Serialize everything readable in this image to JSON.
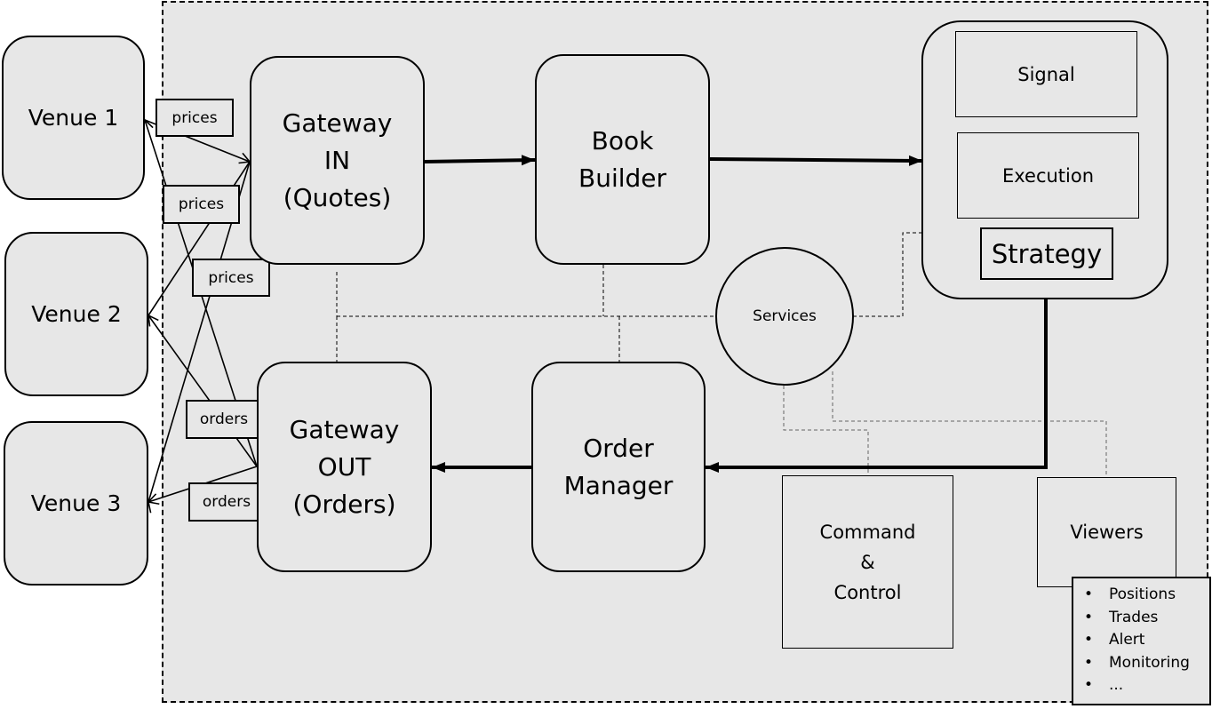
{
  "venues": [
    {
      "label": "Venue 1"
    },
    {
      "label": "Venue 2"
    },
    {
      "label": "Venue 3"
    }
  ],
  "flow_labels": {
    "prices": [
      "prices",
      "prices",
      "prices"
    ],
    "orders": [
      "orders",
      "orders"
    ]
  },
  "components": {
    "gateway_in": "Gateway\nIN\n(Quotes)",
    "book_builder": "Book\nBuilder",
    "strategy": {
      "title": "Strategy",
      "signal": "Signal",
      "execution": "Execution"
    },
    "services": "Services",
    "gateway_out": "Gateway\nOUT\n(Orders)",
    "order_manager": "Order\nManager",
    "command_control": "Command\n&\nControl",
    "viewers": {
      "title": "Viewers",
      "items": [
        "Positions",
        "Trades",
        "Alert",
        "Monitoring",
        "..."
      ]
    }
  }
}
